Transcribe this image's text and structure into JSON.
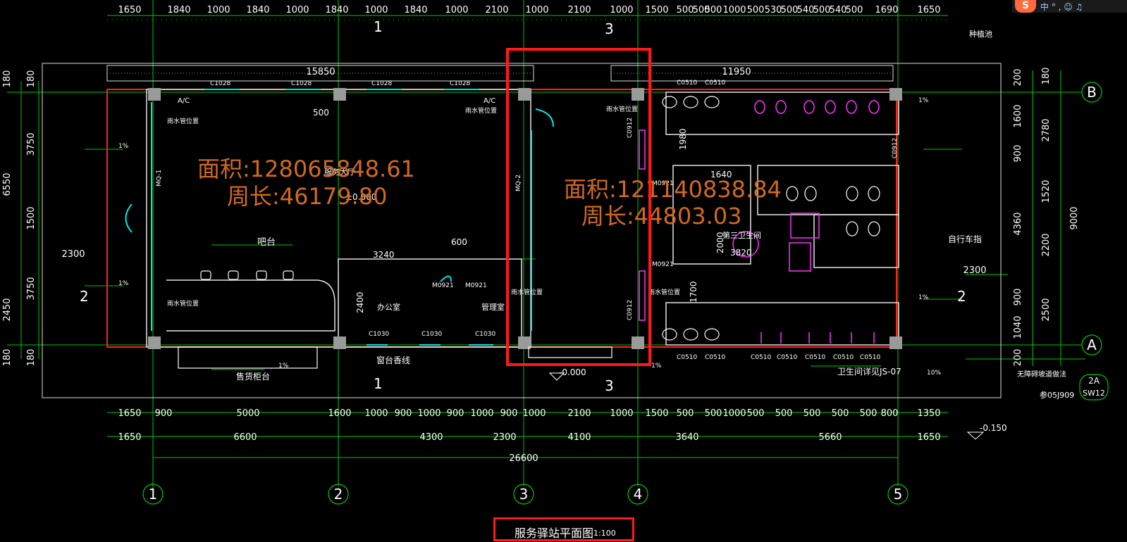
{
  "plan": {
    "title": "服务驿站平面图",
    "scale": "1:100",
    "area_left": "面积:128065848.61",
    "perimeter_left": "周长:46179.80",
    "area_mid": "面积:121140838.84",
    "perimeter_mid": "周长:44803.03"
  },
  "top_dims": [
    "1650",
    "1840",
    "1000",
    "1840",
    "1000",
    "1840",
    "1000",
    "1840",
    "1000",
    "2100",
    "1000",
    "1500",
    "500",
    "500",
    "500",
    "1000",
    "500",
    "530",
    "500",
    "540",
    "500",
    "540",
    "500",
    "1690",
    "1650"
  ],
  "bottom_dims_1": [
    "1650",
    "900",
    "5000",
    "1600",
    "1000",
    "900",
    "1000",
    "900",
    "1000",
    "900",
    "1000",
    "900",
    "2100",
    "1000",
    "1500",
    "500",
    "500",
    "1000",
    "500",
    "500",
    "500",
    "500",
    "500",
    "800",
    "1350"
  ],
  "bottom_dims_2": [
    "1650",
    "6600",
    "4300",
    "2300",
    "4100",
    "3640",
    "5660",
    "1650"
  ],
  "total_dim": "26600",
  "left_dims": [
    "180",
    "3750",
    "1500",
    "3750",
    "180"
  ],
  "left_dims_b": [
    "180",
    "6550",
    "2300",
    "2450",
    "180"
  ],
  "right_dims": [
    "200",
    "1600",
    "900",
    "1520",
    "2200",
    "900",
    "2500",
    "1040",
    "200"
  ],
  "right_dims_b": [
    "180",
    "2780",
    "4360",
    "9000",
    "2300"
  ],
  "axes_x": [
    "1",
    "2",
    "3",
    "4",
    "5"
  ],
  "axes_y": [
    "B",
    "A"
  ],
  "section_labels": {
    "one": "1",
    "two": "2",
    "three": "3"
  },
  "labels": {
    "wall_15850": "15850",
    "wall_11950": "11950",
    "service_hall": "服务大厅",
    "elev_000": "±0.000",
    "elev_m000": "-0.000",
    "elev_m150": "-0.150",
    "counter": "吧台",
    "window_line": "窗台香线",
    "sales_cabinet": "售货柜台",
    "office": "办公室",
    "manage_room": "管理室",
    "third_toilet": "第三卫生间",
    "bike_lane": "自行车指",
    "barrier_free": "无障碍坡道做法",
    "toilet_detail": "卫生间详见JS-07",
    "ref_code": "参05J909",
    "ref_2a": "2A",
    "ref_sw12": "SW12",
    "fill_pool": "种植池",
    "rain_pipe": "雨水管位置",
    "slope": "1%",
    "slope10": "10%",
    "mq1": "MQ-1",
    "mq2": "MQ-2",
    "c1028": "C1028",
    "c1030": "C1030",
    "c0510": "C0510",
    "c0912": "C0912",
    "m0921": "M0921",
    "ac": "A/C",
    "d3820": "3820",
    "d2400": "2400",
    "d3240": "3240",
    "d600": "600",
    "d500": "500",
    "d1640": "1640",
    "d1980": "1980",
    "d2000": "2000",
    "d1700": "1700"
  },
  "ui": {
    "logo": "S",
    "tray": "中 ° , ☺ ♫"
  }
}
